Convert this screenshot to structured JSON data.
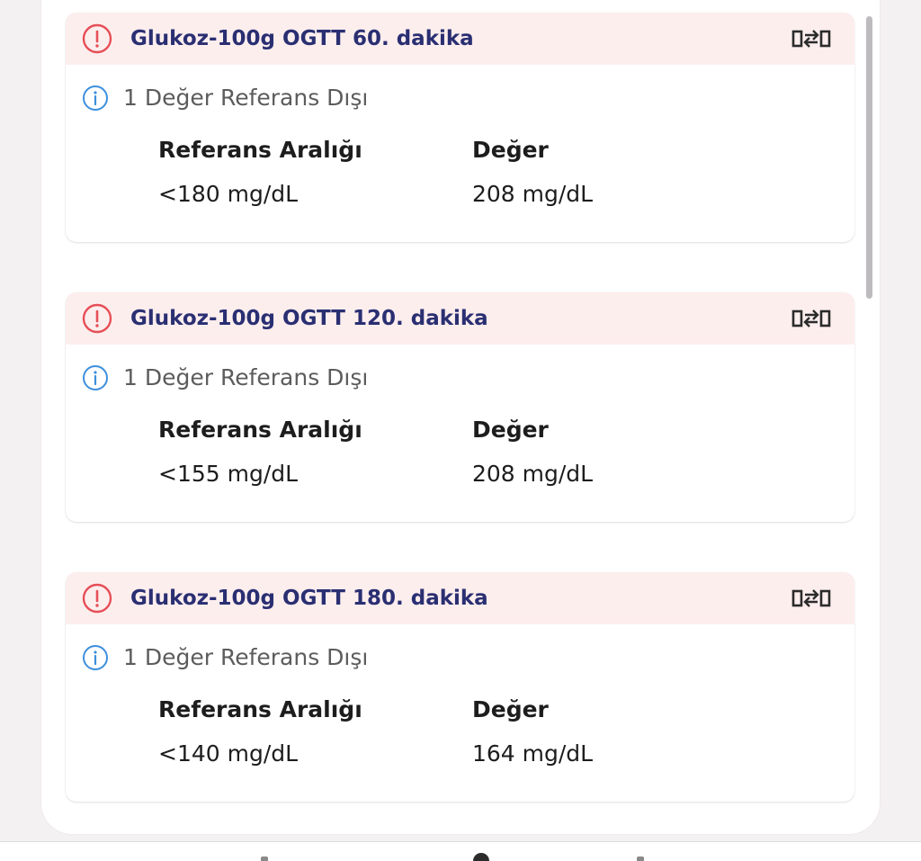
{
  "cards": [
    {
      "title": "Glukoz-100g OGTT 60. dakika",
      "info": "1 Değer Referans Dışı",
      "reference_header": "Referans Aralığı",
      "value_header": "Değer",
      "reference_value": "<180 mg/dL",
      "value": "208 mg/dL"
    },
    {
      "title": "Glukoz-100g OGTT 120. dakika",
      "info": "1 Değer Referans Dışı",
      "reference_header": "Referans Aralığı",
      "value_header": "Değer",
      "reference_value": "<155 mg/dL",
      "value": "208 mg/dL"
    },
    {
      "title": "Glukoz-100g OGTT 180. dakika",
      "info": "1 Değer Referans Dışı",
      "reference_header": "Referans Aralığı",
      "value_header": "Değer",
      "reference_value": "<140 mg/dL",
      "value": "164 mg/dL"
    }
  ],
  "icons": {
    "alert": "alert-circle-icon",
    "info": "info-circle-icon",
    "compare": "compare-swap-icon"
  },
  "colors": {
    "alert_red": "#e64f57",
    "info_blue": "#3d8fdd",
    "title_navy": "#2a2f72",
    "header_pink": "#fdeeee"
  }
}
